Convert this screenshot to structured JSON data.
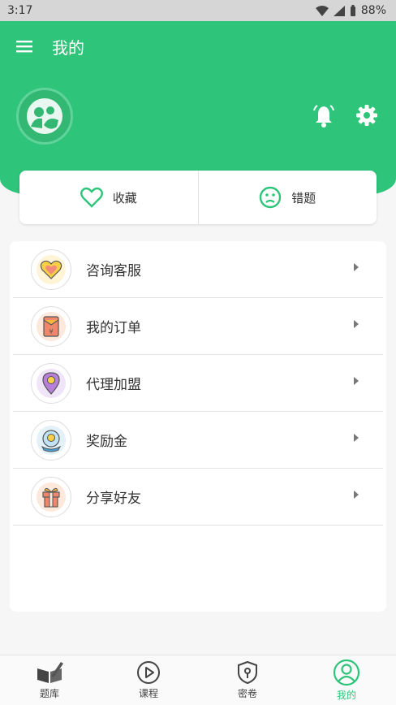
{
  "status_bar": {
    "time": "3:17",
    "battery": "88%"
  },
  "header": {
    "title": "我的"
  },
  "quick_actions": [
    {
      "label": "收藏",
      "icon": "heart-icon"
    },
    {
      "label": "错题",
      "icon": "sad-face-icon"
    }
  ],
  "menu": [
    {
      "label": "咨询客服",
      "icon": "heart-badge-icon"
    },
    {
      "label": "我的订单",
      "icon": "envelope-icon"
    },
    {
      "label": "代理加盟",
      "icon": "location-pin-icon"
    },
    {
      "label": "奖励金",
      "icon": "coin-globe-icon"
    },
    {
      "label": "分享好友",
      "icon": "gift-icon"
    }
  ],
  "bottom_nav": [
    {
      "label": "题库",
      "icon": "book-pen-icon",
      "active": false
    },
    {
      "label": "课程",
      "icon": "play-circle-icon",
      "active": false
    },
    {
      "label": "密卷",
      "icon": "lock-shield-icon",
      "active": false
    },
    {
      "label": "我的",
      "icon": "user-circle-icon",
      "active": true
    }
  ],
  "colors": {
    "accent": "#2ec47a",
    "status_bar": "#d6d6d6"
  }
}
